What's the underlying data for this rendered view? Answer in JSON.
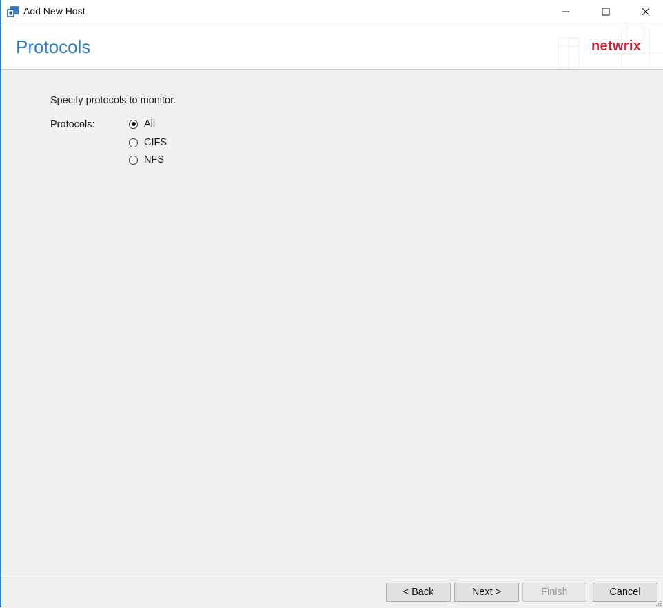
{
  "window": {
    "title": "Add New Host",
    "controls": {
      "minimize": "—",
      "maximize": "☐",
      "close": "✕"
    }
  },
  "header": {
    "title": "Protocols",
    "brand": "netwrix"
  },
  "main": {
    "instruction": "Specify protocols to monitor.",
    "protocols_label": "Protocols:",
    "options": [
      {
        "label": "All",
        "checked": true
      },
      {
        "label": "CIFS",
        "checked": false
      },
      {
        "label": "NFS",
        "checked": false
      }
    ]
  },
  "footer": {
    "back_label": "< Back",
    "next_label": "Next >",
    "finish_label": "Finish",
    "cancel_label": "Cancel"
  },
  "colors": {
    "accent": "#2e7fc6",
    "brand": "#d0243a",
    "window_border": "#2b79c9"
  }
}
